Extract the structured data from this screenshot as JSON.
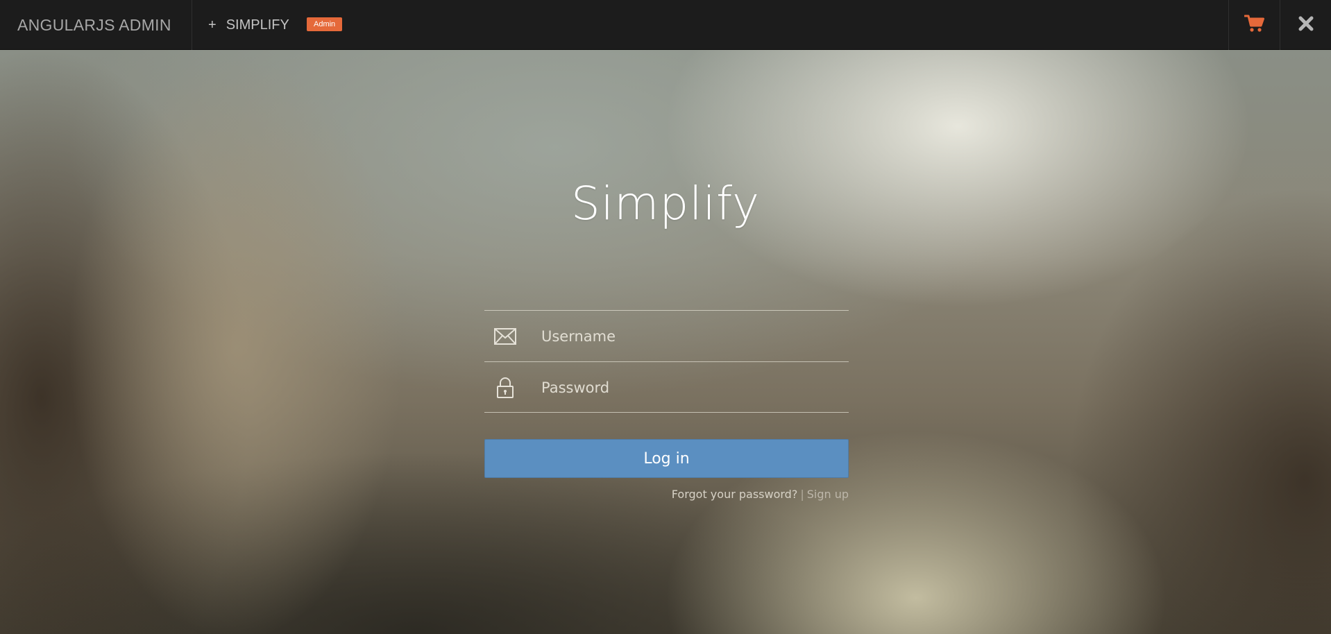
{
  "topbar": {
    "brand": "ANGULARJS ADMIN",
    "nav_plus": "+",
    "nav_label": "SIMPLIFY",
    "badge": "Admin",
    "cart_icon": "shopping-cart-icon",
    "close_icon": "close-icon"
  },
  "login": {
    "title": "Simplify",
    "username": {
      "placeholder": "Username",
      "value": "",
      "icon": "envelope-icon"
    },
    "password": {
      "placeholder": "Password",
      "value": "",
      "icon": "lock-icon"
    },
    "submit_label": "Log in",
    "forgot_label": "Forgot your password?",
    "separator": "|",
    "signup_label": "Sign up"
  },
  "colors": {
    "topbar_bg": "#1c1c1c",
    "accent_orange": "#e5693a",
    "button_blue": "#5b8fc1"
  }
}
